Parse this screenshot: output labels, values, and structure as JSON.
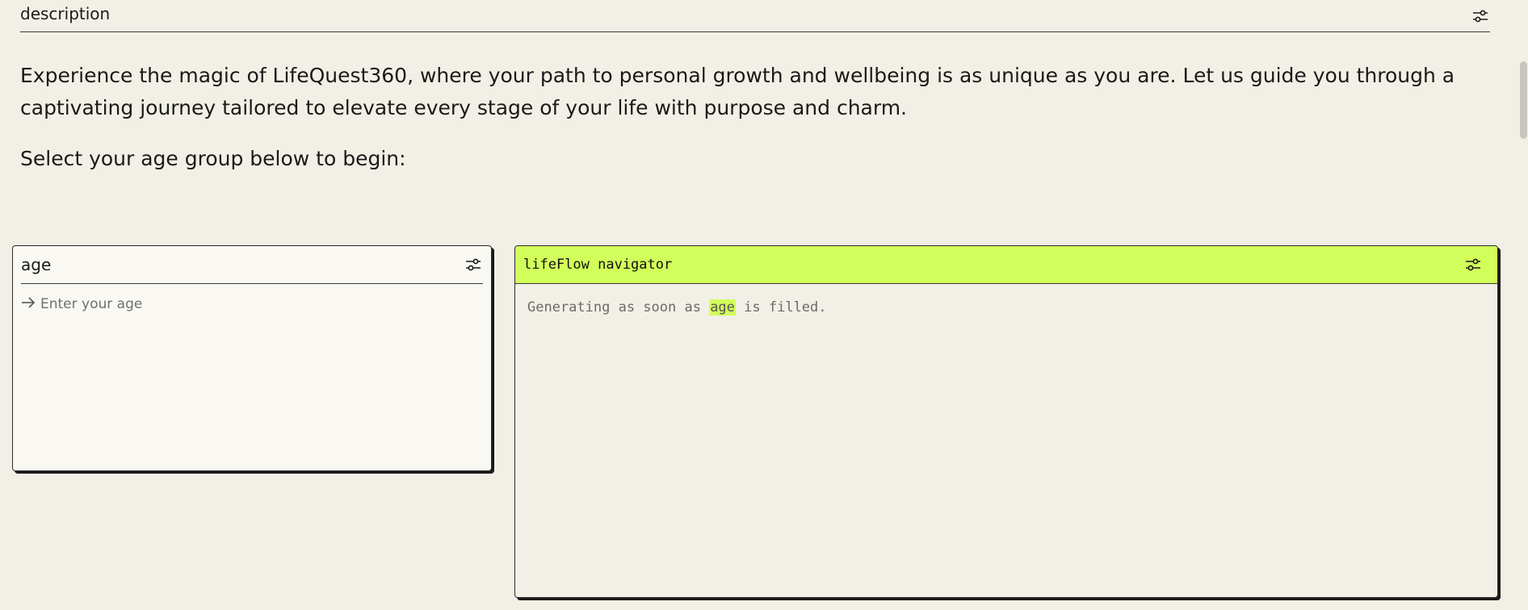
{
  "description_header": {
    "label": "description",
    "settings_icon": "sliders-icon"
  },
  "intro_text": "Experience the magic of LifeQuest360, where your path to personal growth and wellbeing is as unique as you are. Let us guide you through a captivating journey tailored to elevate every stage of your life with purpose and charm.",
  "prompt_text": "Select your age group below to begin:",
  "age_card": {
    "title": "age",
    "settings_icon": "sliders-icon",
    "input_icon": "arrow-right-icon",
    "input_value": "",
    "input_placeholder": "Enter your age"
  },
  "navigator_card": {
    "title": "lifeFlow navigator",
    "settings_icon": "sliders-icon",
    "status_prefix": "Generating as soon as",
    "status_highlight": "age",
    "status_suffix": "is filled.",
    "accent_color": "#d1fe5a"
  },
  "colors": {
    "background": "#f2f0e6",
    "accent": "#d1fe5a",
    "text": "#1a1a1a"
  }
}
